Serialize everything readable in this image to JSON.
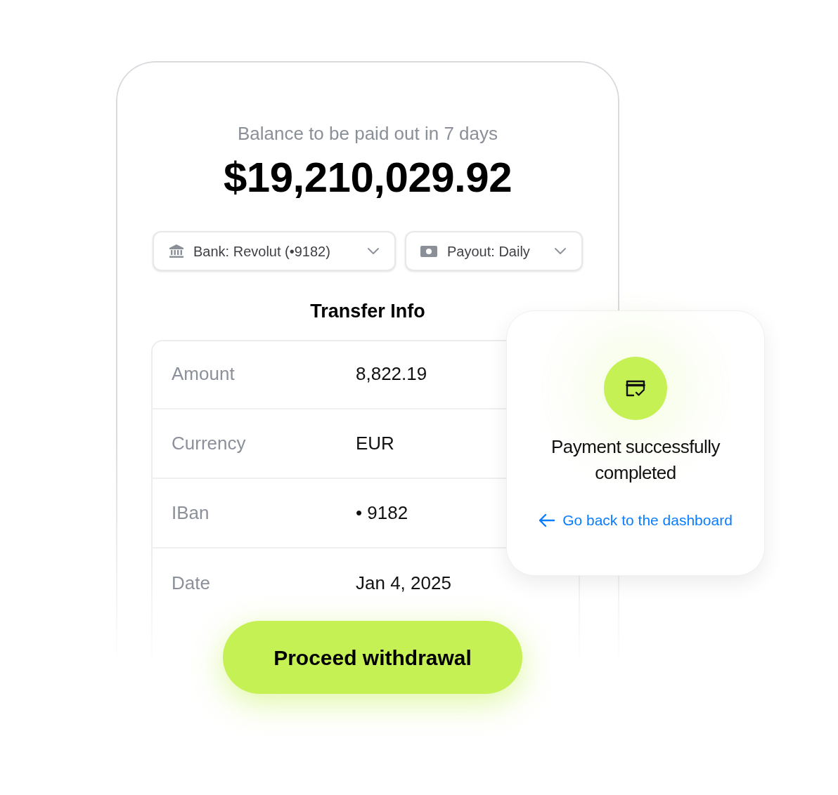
{
  "balance": {
    "label": "Balance to be paid out in 7 days",
    "amount": "$19,210,029.92"
  },
  "selectors": [
    {
      "kind": "bank",
      "label": "Bank: Revolut (•9182)"
    },
    {
      "kind": "payout",
      "label": "Payout: Daily"
    }
  ],
  "transfer_info": {
    "title": "Transfer Info",
    "rows": [
      {
        "label": "Amount",
        "value": "8,822.19"
      },
      {
        "label": "Currency",
        "value": "EUR"
      },
      {
        "label": "IBan",
        "value": "• 9182"
      },
      {
        "label": "Date",
        "value": "Jan 4, 2025"
      }
    ]
  },
  "primary_button": {
    "label": "Proceed withdrawal"
  },
  "success_card": {
    "message": "Payment successfully completed",
    "link": "Go back to the dashboard"
  }
}
